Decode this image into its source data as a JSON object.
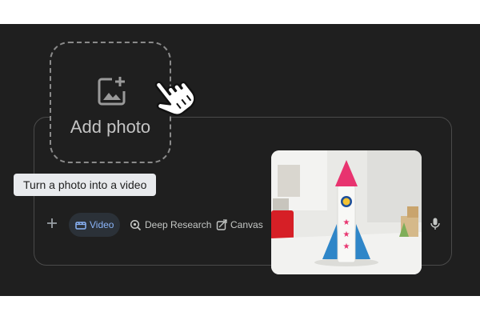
{
  "add_card": {
    "label": "Add photo",
    "icon": "add-image-icon"
  },
  "tooltip": {
    "text": "Turn a photo into a video"
  },
  "toolbar": {
    "add_icon": "plus-icon",
    "video_label": "Video",
    "deep_research_label": "Deep Research",
    "canvas_label": "Canvas",
    "mic_icon": "microphone-icon"
  },
  "photo": {
    "subject": "paper rocket toy"
  },
  "colors": {
    "background": "#1f1f1f",
    "accent": "#8ab4f8",
    "rocket_nose": "#e8336f",
    "rocket_fins": "#2f86c8"
  }
}
